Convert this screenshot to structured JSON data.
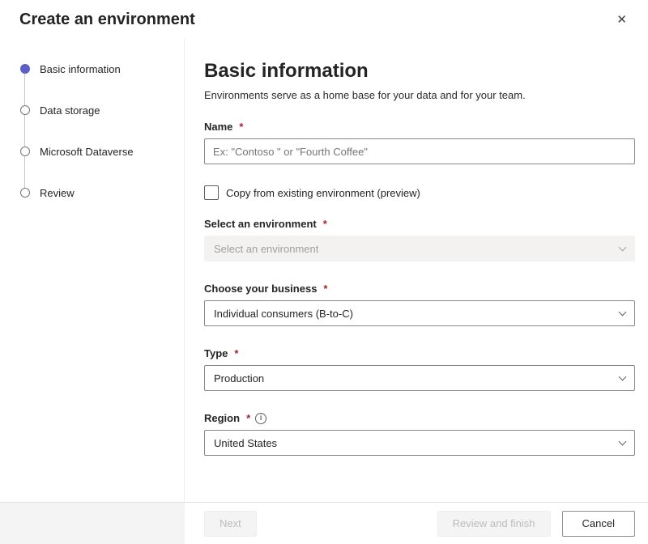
{
  "dialog": {
    "title": "Create an environment",
    "close_glyph": "✕"
  },
  "stepper": {
    "items": [
      {
        "label": "Basic information",
        "state": "current"
      },
      {
        "label": "Data storage",
        "state": "pending"
      },
      {
        "label": "Microsoft Dataverse",
        "state": "pending"
      },
      {
        "label": "Review",
        "state": "pending"
      }
    ]
  },
  "main": {
    "heading": "Basic information",
    "description": "Environments serve as a home base for your data and for your team.",
    "fields": {
      "name": {
        "label": "Name",
        "required_mark": "*",
        "value": "",
        "placeholder": "Ex: \"Contoso \" or \"Fourth Coffee\""
      },
      "copy_from_existing": {
        "label": "Copy from existing environment (preview)",
        "checked": false
      },
      "select_environment": {
        "label": "Select an environment",
        "required_mark": "*",
        "value": "Select an environment",
        "disabled": true
      },
      "business": {
        "label": "Choose your business",
        "required_mark": "*",
        "value": "Individual consumers (B-to-C)"
      },
      "type": {
        "label": "Type",
        "required_mark": "*",
        "value": "Production"
      },
      "region": {
        "label": "Region",
        "required_mark": "*",
        "info_glyph": "i",
        "value": "United States"
      }
    }
  },
  "footer": {
    "next_label": "Next",
    "review_and_finish_label": "Review and finish",
    "cancel_label": "Cancel"
  },
  "colors": {
    "accent": "#5b5fc7",
    "required": "#a4262c",
    "disabled_bg": "#f3f2f1",
    "disabled_text": "#a19f9d"
  }
}
